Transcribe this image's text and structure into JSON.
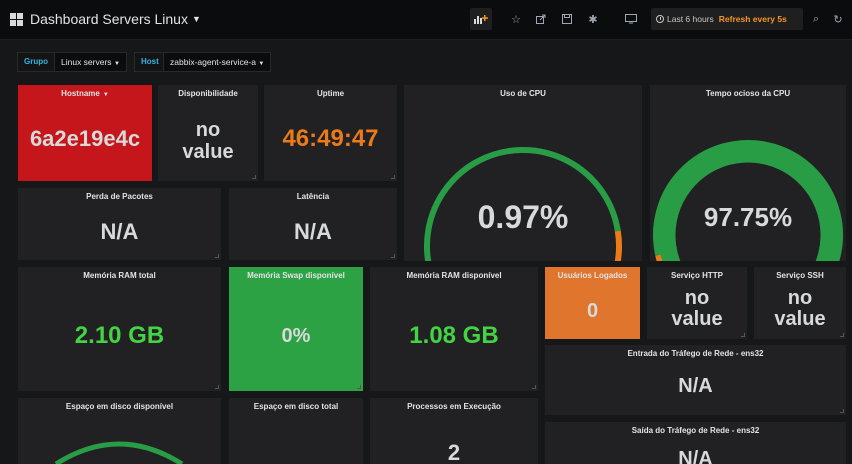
{
  "navbar": {
    "title": "Dashboard Servers Linux",
    "time_range": "Last 6 hours",
    "refresh": "Refresh every 5s"
  },
  "variables": [
    {
      "label": "Grupo",
      "value": "Linux servers"
    },
    {
      "label": "Host",
      "value": "zabbix-agent-service-a"
    }
  ],
  "panels": {
    "hostname": {
      "title": "Hostname",
      "value": "6a2e19e4c"
    },
    "disponibilidade": {
      "title": "Disponibilidade",
      "value_line1": "no",
      "value_line2": "value"
    },
    "uptime": {
      "title": "Uptime",
      "value": "46:49:47"
    },
    "cpu_use": {
      "title": "Uso de CPU",
      "value": "0.97%",
      "percent": 0.97
    },
    "cpu_idle": {
      "title": "Tempo ocioso da CPU",
      "value": "97.75%",
      "percent": 97.75
    },
    "perda_pacotes": {
      "title": "Perda de Pacotes",
      "value": "N/A"
    },
    "latencia": {
      "title": "Latência",
      "value": "N/A"
    },
    "ram_total": {
      "title": "Memória RAM total",
      "value": "2.10 GB"
    },
    "swap": {
      "title": "Memória Swap disponível",
      "value": "0%"
    },
    "ram_disp": {
      "title": "Memória RAM disponível",
      "value": "1.08 GB"
    },
    "usuarios": {
      "title": "Usuários Logados",
      "value": "0"
    },
    "http": {
      "title": "Serviço HTTP",
      "value_line1": "no",
      "value_line2": "value"
    },
    "ssh": {
      "title": "Serviço SSH",
      "value_line1": "no",
      "value_line2": "value"
    },
    "trafego_in": {
      "title": "Entrada do Tráfego de Rede - ens32",
      "value": "N/A"
    },
    "disco_disp": {
      "title": "Espaço em disco disponível"
    },
    "disco_total": {
      "title": "Espaço em disco total"
    },
    "processos": {
      "title": "Processos em Execução",
      "value": "2"
    },
    "trafego_out": {
      "title": "Saída do Tráfego de Rede - ens32",
      "value": "N/A"
    }
  },
  "colors": {
    "background": "#161719",
    "panel": "#212124",
    "green": "#299c46",
    "text_green": "#43d343",
    "orange": "#eb7b18",
    "red": "#d44a3a",
    "bright_red": "#e02f44",
    "accent_blue": "#33b5e5"
  }
}
